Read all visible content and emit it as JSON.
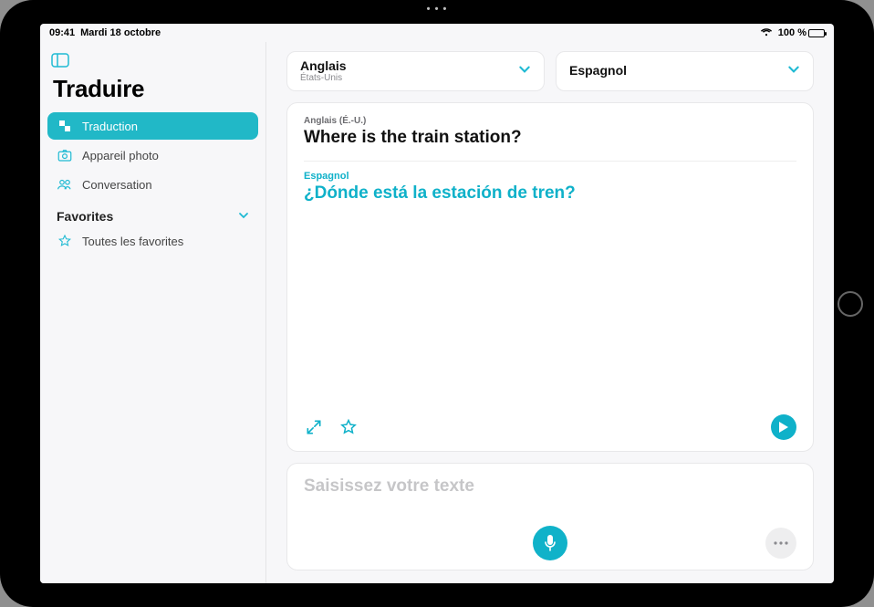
{
  "status": {
    "time": "09:41",
    "date": "Mardi 18 octobre",
    "battery_text": "100 %",
    "wifi_icon": "wifi"
  },
  "sidebar": {
    "title": "Traduire",
    "items": [
      {
        "label": "Traduction",
        "icon": "translate-icon",
        "active": true
      },
      {
        "label": "Appareil photo",
        "icon": "camera-icon",
        "active": false
      },
      {
        "label": "Conversation",
        "icon": "people-icon",
        "active": false
      }
    ],
    "section_label": "Favorites",
    "favorites_item": "Toutes les favorites"
  },
  "languages": {
    "source": {
      "name": "Anglais",
      "region": "États-Unis"
    },
    "target": {
      "name": "Espagnol",
      "region": ""
    }
  },
  "translation": {
    "source_label": "Anglais (É.-U.)",
    "source_text": "Where is the train station?",
    "target_label": "Espagnol",
    "target_text": "¿Dónde está la estación de tren?"
  },
  "input": {
    "placeholder": "Saisissez votre texte"
  },
  "colors": {
    "accent": "#10b2c9"
  }
}
